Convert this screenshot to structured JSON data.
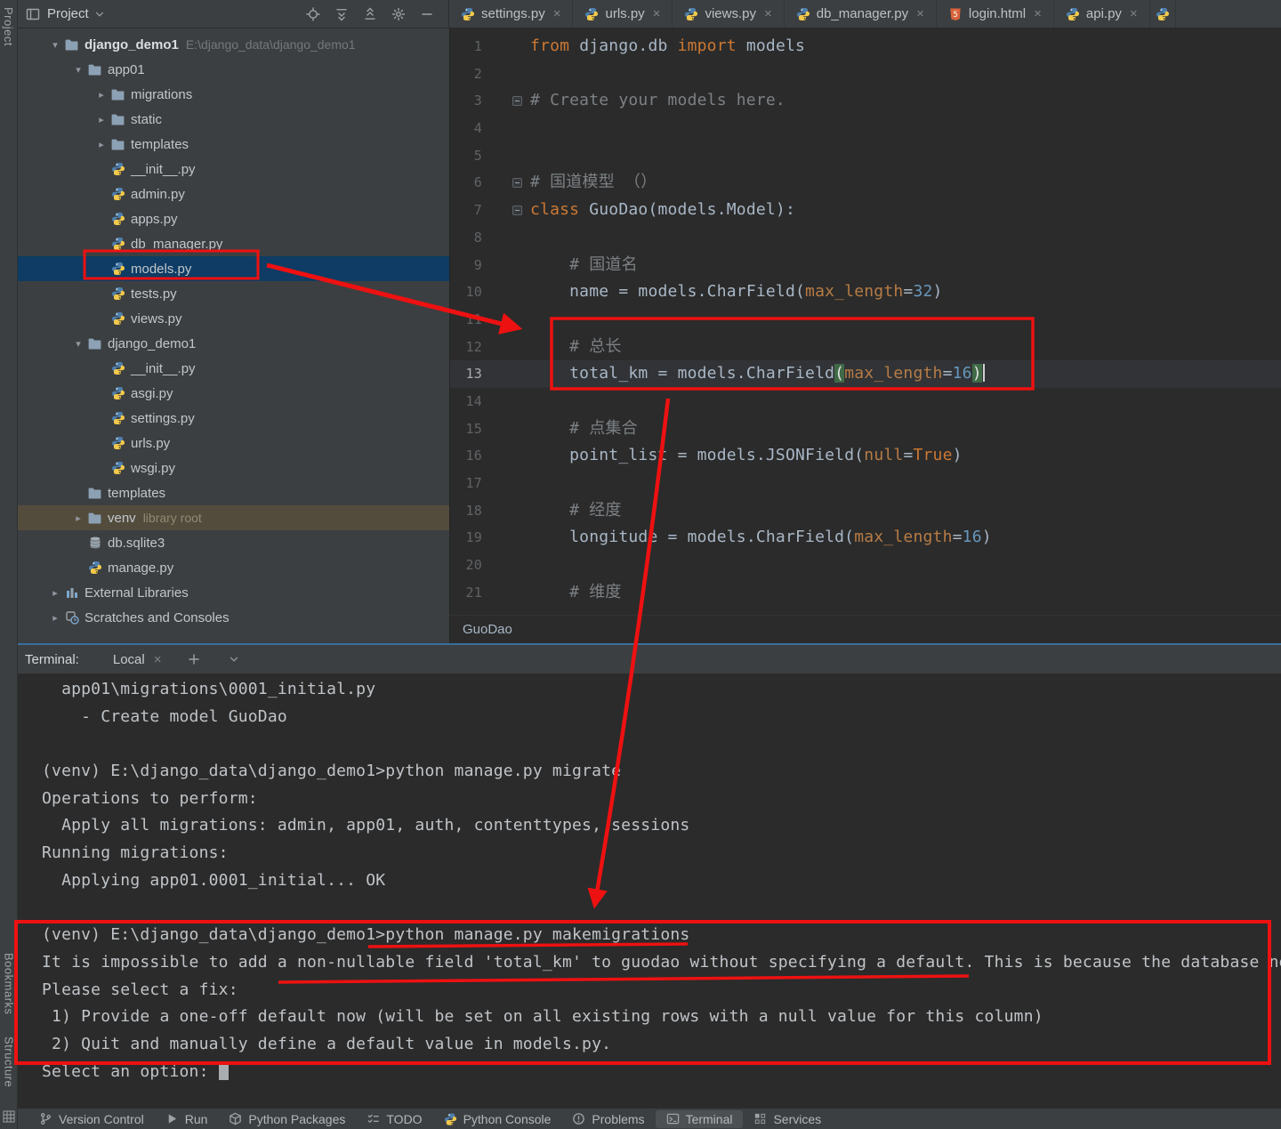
{
  "colors": {
    "annotation": "#ee1111",
    "selection_blue": "#0e3c64",
    "venv_highlight": "#534c3d",
    "terminal_focus": "#3a6f9e"
  },
  "left_strip": {
    "top": "Project",
    "bottom": [
      "Bookmarks",
      "Structure"
    ]
  },
  "project_header": {
    "title": "Project"
  },
  "editor_tabs": [
    {
      "label": "settings.py",
      "icon": "python-file"
    },
    {
      "label": "urls.py",
      "icon": "python-file"
    },
    {
      "label": "views.py",
      "icon": "python-file"
    },
    {
      "label": "db_manager.py",
      "icon": "python-file"
    },
    {
      "label": "login.html",
      "icon": "html-file"
    },
    {
      "label": "api.py",
      "icon": "python-file"
    },
    {
      "label": "",
      "icon": "python-file",
      "partial": true
    }
  ],
  "tree": [
    {
      "d": 1,
      "chev": "down",
      "icon": "folder",
      "label": "django_demo1",
      "suffix": "E:\\django_data\\django_demo1",
      "bold": true
    },
    {
      "d": 2,
      "chev": "down",
      "icon": "folder",
      "label": "app01"
    },
    {
      "d": 3,
      "chev": "right",
      "icon": "folder",
      "label": "migrations"
    },
    {
      "d": 3,
      "chev": "right",
      "icon": "folder",
      "label": "static"
    },
    {
      "d": 3,
      "chev": "right",
      "icon": "folder",
      "label": "templates"
    },
    {
      "d": 3,
      "icon": "python-file",
      "label": "__init__.py"
    },
    {
      "d": 3,
      "icon": "python-file",
      "label": "admin.py"
    },
    {
      "d": 3,
      "icon": "python-file",
      "label": "apps.py"
    },
    {
      "d": 3,
      "icon": "python-file",
      "label": "db_manager.py"
    },
    {
      "d": 3,
      "icon": "python-file",
      "label": "models.py",
      "selected": true
    },
    {
      "d": 3,
      "icon": "python-file",
      "label": "tests.py"
    },
    {
      "d": 3,
      "icon": "python-file",
      "label": "views.py"
    },
    {
      "d": 2,
      "chev": "down",
      "icon": "folder",
      "label": "django_demo1"
    },
    {
      "d": 3,
      "icon": "python-file",
      "label": "__init__.py"
    },
    {
      "d": 3,
      "icon": "python-file",
      "label": "asgi.py"
    },
    {
      "d": 3,
      "icon": "python-file",
      "label": "settings.py"
    },
    {
      "d": 3,
      "icon": "python-file",
      "label": "urls.py"
    },
    {
      "d": 3,
      "icon": "python-file",
      "label": "wsgi.py"
    },
    {
      "d": 2,
      "icon": "folder",
      "label": "templates"
    },
    {
      "d": 2,
      "chev": "right",
      "icon": "folder",
      "label": "venv",
      "suffix": "library root",
      "venv": true
    },
    {
      "d": 2,
      "icon": "db-file",
      "label": "db.sqlite3"
    },
    {
      "d": 2,
      "icon": "python-file",
      "label": "manage.py"
    },
    {
      "d": 1,
      "chev": "right",
      "icon": "libraries",
      "label": "External Libraries"
    },
    {
      "d": 1,
      "chev": "right",
      "icon": "scratches",
      "label": "Scratches and Consoles"
    }
  ],
  "editor": {
    "breadcrumb": "GuoDao",
    "lines": [
      {
        "n": 1,
        "seg": [
          [
            "k",
            "from"
          ],
          [
            "p",
            " django.db "
          ],
          [
            "k",
            "import"
          ],
          [
            "p",
            " models"
          ]
        ]
      },
      {
        "n": 2,
        "seg": []
      },
      {
        "n": 3,
        "fold": true,
        "seg": [
          [
            "c",
            "# Create your models here."
          ]
        ]
      },
      {
        "n": 4,
        "seg": []
      },
      {
        "n": 5,
        "seg": []
      },
      {
        "n": 6,
        "fold": true,
        "seg": [
          [
            "c",
            "# 国道模型 （）"
          ]
        ]
      },
      {
        "n": 7,
        "fold": true,
        "seg": [
          [
            "k",
            "class"
          ],
          [
            "p",
            " GuoDao(models.Model):"
          ]
        ]
      },
      {
        "n": 8,
        "seg": []
      },
      {
        "n": 9,
        "seg": [
          [
            "c",
            "    # 国道名"
          ]
        ]
      },
      {
        "n": 10,
        "seg": [
          [
            "v",
            "    name"
          ],
          [
            "p",
            " = models.CharField("
          ],
          [
            "a",
            "max_length"
          ],
          [
            "p",
            "="
          ],
          [
            "num",
            "32"
          ],
          [
            "p",
            ")"
          ]
        ]
      },
      {
        "n": 11,
        "seg": []
      },
      {
        "n": 12,
        "seg": [
          [
            "c",
            "    # 总长"
          ]
        ]
      },
      {
        "n": 13,
        "cur": true,
        "seg": [
          [
            "v",
            "    total_km"
          ],
          [
            "p",
            " = models.CharField"
          ],
          [
            "m",
            "("
          ],
          [
            "a",
            "max_length"
          ],
          [
            "p",
            "="
          ],
          [
            "num",
            "16"
          ],
          [
            "m",
            ")"
          ]
        ]
      },
      {
        "n": 14,
        "seg": []
      },
      {
        "n": 15,
        "seg": [
          [
            "c",
            "    # 点集合"
          ]
        ]
      },
      {
        "n": 16,
        "seg": [
          [
            "v",
            "    point_list"
          ],
          [
            "p",
            " = models.JSONField("
          ],
          [
            "a",
            "null"
          ],
          [
            "p",
            "="
          ],
          [
            "k",
            "True"
          ],
          [
            "p",
            ")"
          ]
        ]
      },
      {
        "n": 17,
        "seg": []
      },
      {
        "n": 18,
        "seg": [
          [
            "c",
            "    # 经度"
          ]
        ]
      },
      {
        "n": 19,
        "seg": [
          [
            "v",
            "    longitude"
          ],
          [
            "p",
            " = models.CharField("
          ],
          [
            "a",
            "max_length"
          ],
          [
            "p",
            "="
          ],
          [
            "num",
            "16"
          ],
          [
            "p",
            ")"
          ]
        ]
      },
      {
        "n": 20,
        "seg": []
      },
      {
        "n": 21,
        "seg": [
          [
            "c",
            "    # 维度"
          ]
        ]
      }
    ]
  },
  "terminal": {
    "label": "Terminal:",
    "tab": "Local",
    "lines": [
      "  app01\\migrations\\0001_initial.py",
      "    - Create model GuoDao",
      "",
      "(venv) E:\\django_data\\django_demo1>python manage.py migrate",
      "Operations to perform:",
      "  Apply all migrations: admin, app01, auth, contenttypes, sessions",
      "Running migrations:",
      "  Applying app01.0001_initial... OK",
      "",
      "(venv) E:\\django_data\\django_demo1>python manage.py makemigrations",
      "It is impossible to add a non-nullable field 'total_km' to guodao without specifying a default. This is because the database ne",
      "Please select a fix:",
      " 1) Provide a one-off default now (will be set on all existing rows with a null value for this column)",
      " 2) Quit and manually define a default value in models.py.",
      "Select an option: "
    ]
  },
  "statusbar": [
    {
      "icon": "vcs-branch",
      "label": "Version Control"
    },
    {
      "icon": "run",
      "label": "Run"
    },
    {
      "icon": "packages",
      "label": "Python Packages"
    },
    {
      "icon": "todo",
      "label": "TODO"
    },
    {
      "icon": "python-file",
      "label": "Python Console"
    },
    {
      "icon": "problems",
      "label": "Problems"
    },
    {
      "icon": "terminal-tool",
      "label": "Terminal",
      "active": true
    },
    {
      "icon": "services",
      "label": "Services"
    }
  ]
}
